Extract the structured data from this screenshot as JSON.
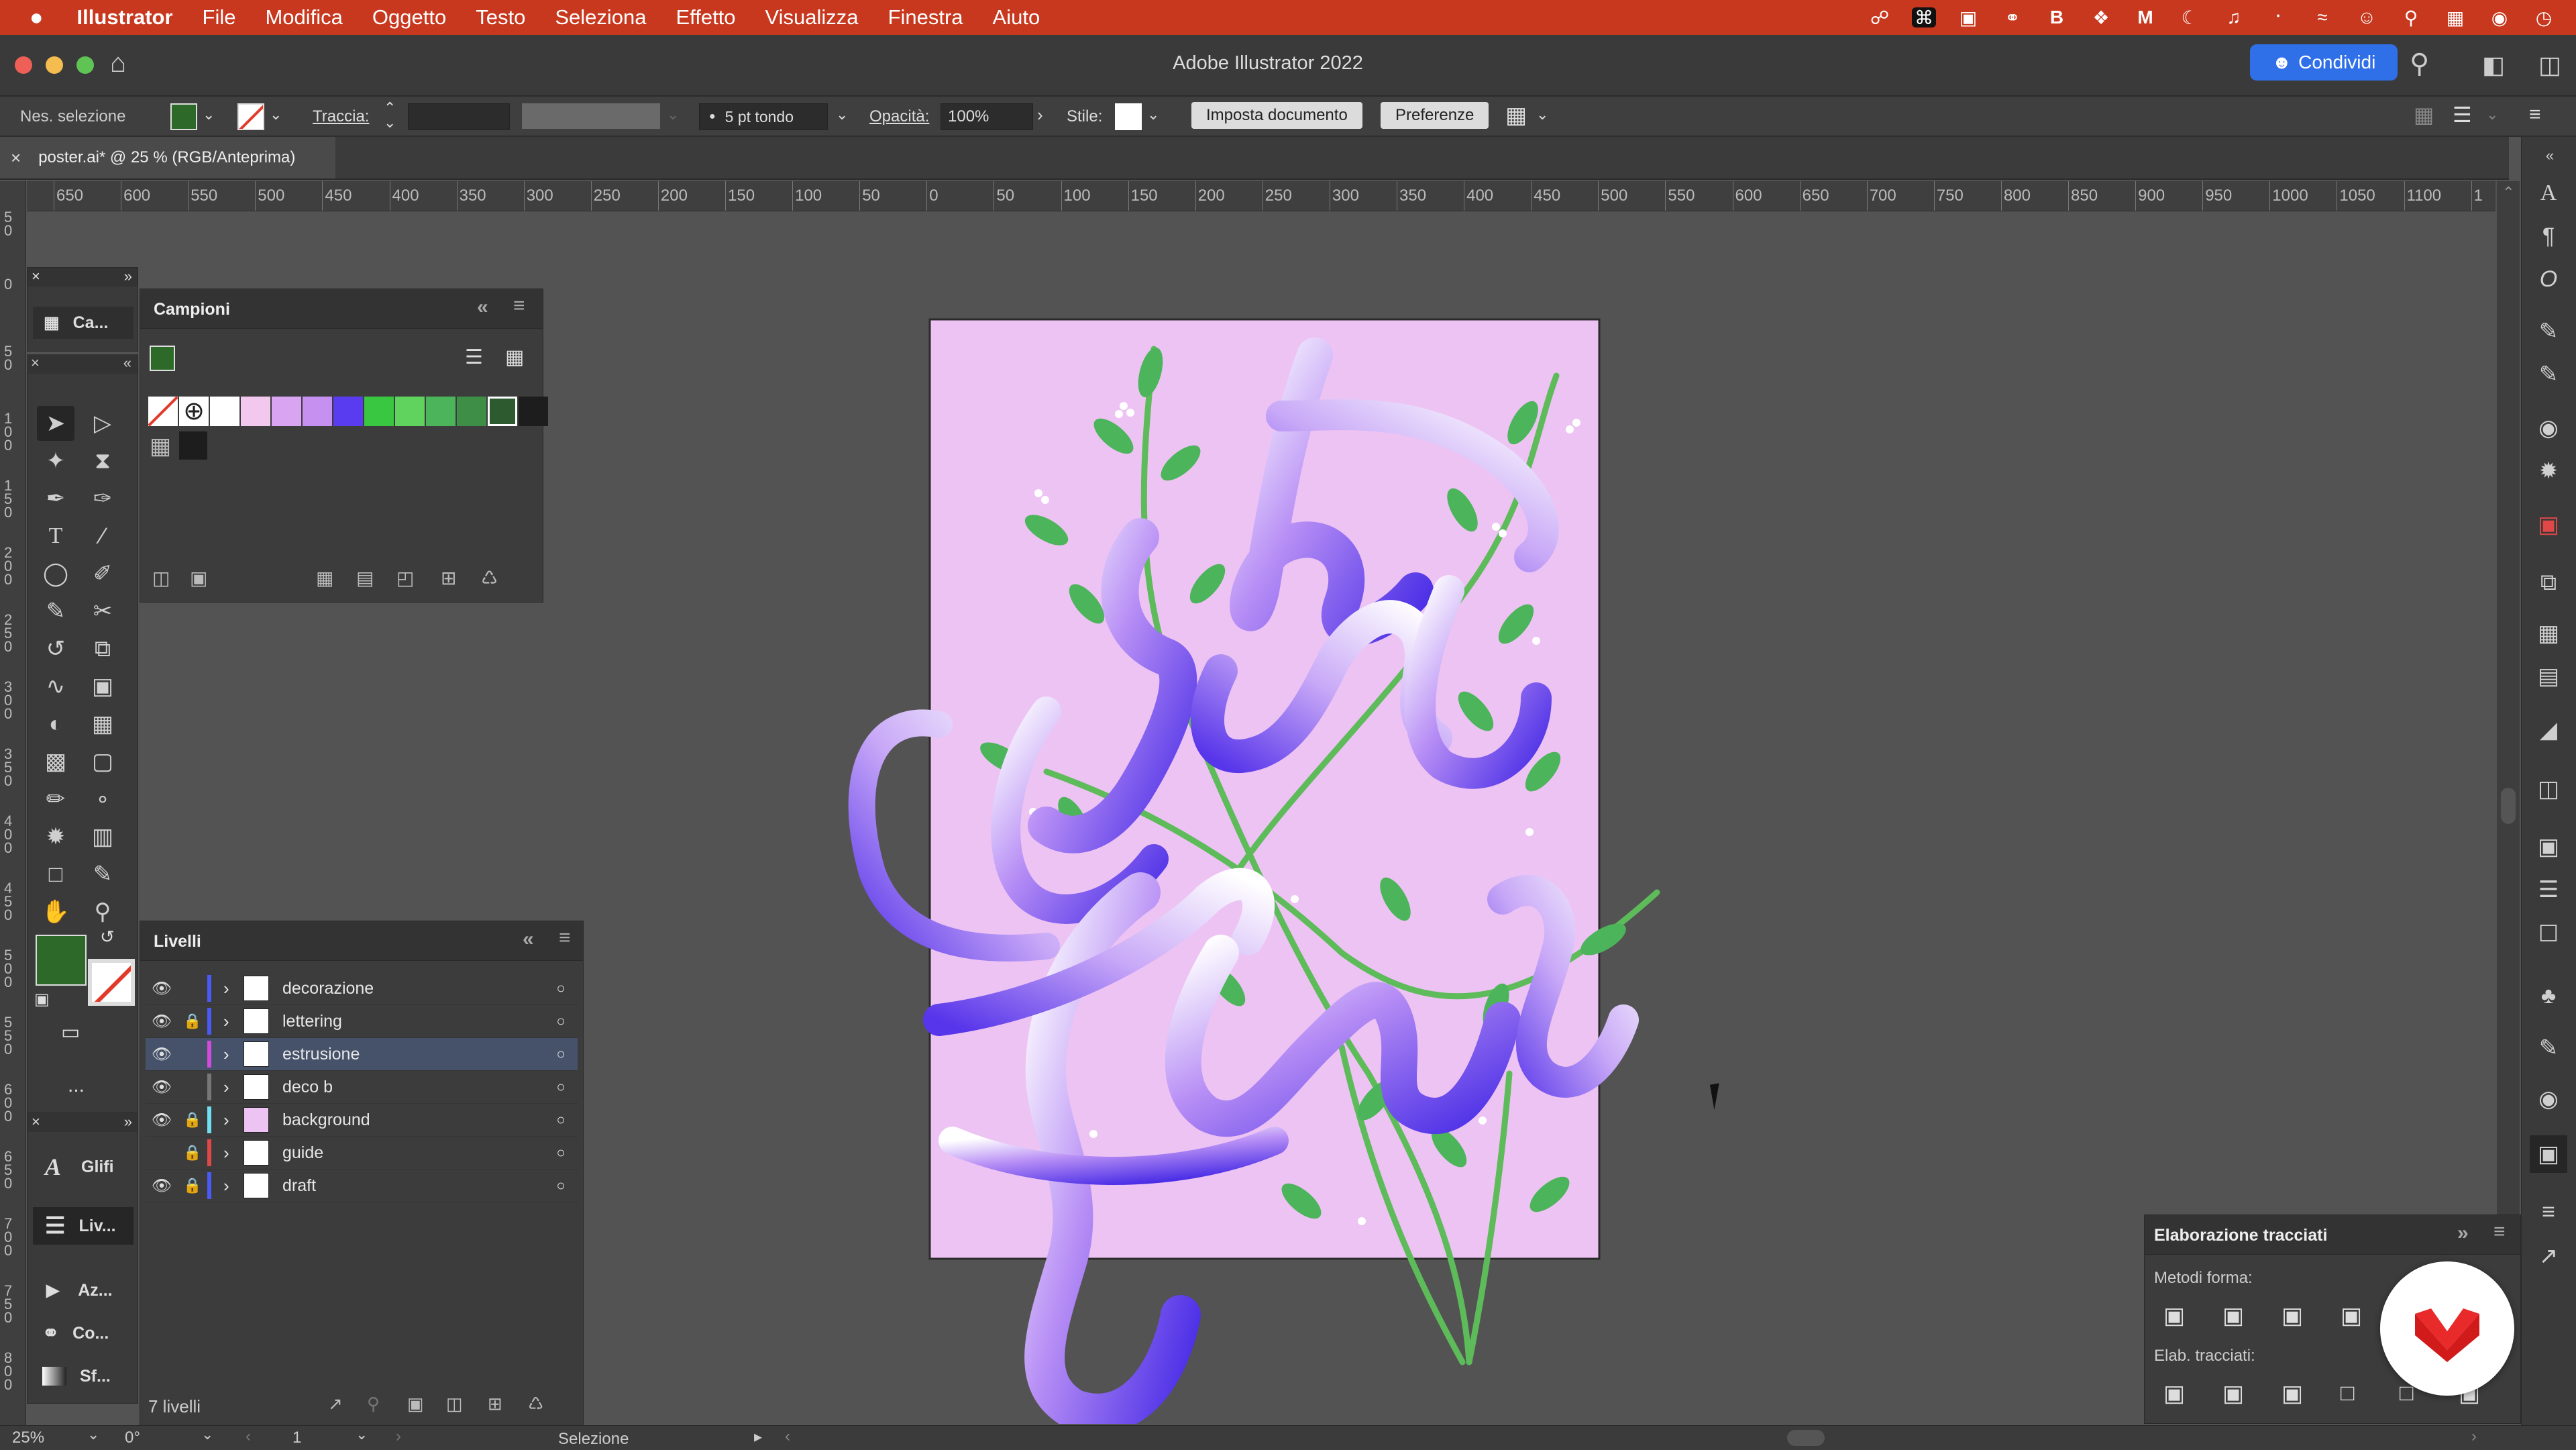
{
  "menubar": {
    "app_name": "Illustrator",
    "items": [
      "File",
      "Modifica",
      "Oggetto",
      "Testo",
      "Seleziona",
      "Effetto",
      "Visualizza",
      "Finestra",
      "Aiuto"
    ],
    "status_icons": [
      "creative-cloud-icon",
      "command-icon",
      "display-icon",
      "sync-icon",
      "b-icon",
      "dropbox-icon",
      "m-icon",
      "moon-icon",
      "headphones-icon",
      "bluetooth-icon",
      "wifi-icon",
      "user-icon",
      "search-icon",
      "control-center-icon",
      "siri-icon",
      "clock-icon"
    ]
  },
  "titlebar": {
    "title": "Adobe Illustrator 2022",
    "share_label": "Condividi"
  },
  "controlbar": {
    "selection_status": "Nes. selezione",
    "stroke_label": "Traccia:",
    "brush_label": "5 pt tondo",
    "opacity_label": "Opacità:",
    "opacity_value": "100%",
    "style_label": "Stile:",
    "document_setup_label": "Imposta documento",
    "preferences_label": "Preferenze"
  },
  "document_tab": {
    "title": "poster.ai* @ 25 % (RGB/Anteprima)"
  },
  "ruler": {
    "horizontal_ticks": [
      "650",
      "600",
      "550",
      "500",
      "450",
      "400",
      "350",
      "300",
      "250",
      "200",
      "150",
      "100",
      "50",
      "0",
      "50",
      "100",
      "150",
      "200",
      "250",
      "300",
      "350",
      "400",
      "450",
      "500",
      "550",
      "600",
      "650",
      "700",
      "750",
      "800",
      "850",
      "900",
      "950",
      "1000",
      "1050",
      "1100",
      "1"
    ],
    "vertical_ticks": [
      "5\n0",
      "0",
      "5\n0",
      "1\n0\n0",
      "1\n5\n0",
      "2\n0\n0",
      "2\n5\n0",
      "3\n0\n0",
      "3\n5\n0",
      "4\n0\n0",
      "4\n5\n0",
      "5\n0\n0",
      "5\n5\n0",
      "6\n0\n0",
      "6\n5\n0",
      "7\n0\n0",
      "7\n5\n0",
      "8\n0\n0"
    ]
  },
  "left_dock": {
    "color_short": "Ca...",
    "glyphs": "Glifi",
    "layers_short": "Liv...",
    "actions_short": "Az...",
    "links_short": "Co...",
    "gradient_short": "Sf...",
    "more": "..."
  },
  "swatches_panel": {
    "title": "Campioni",
    "colors": [
      "#ffffff",
      "#f3c8ee",
      "#d9a4f2",
      "#c690f0",
      "#5a3cf0",
      "#39c640",
      "#5fd35d",
      "#4cb45a",
      "#3e8e48",
      "#2d5b2f",
      "#1d1d1d"
    ]
  },
  "layers_panel": {
    "title": "Livelli",
    "layers": [
      {
        "name": "decorazione",
        "color": "#4a5bf5",
        "locked": false,
        "visible": true,
        "selected": false
      },
      {
        "name": "lettering",
        "color": "#4a5bf5",
        "locked": true,
        "visible": true,
        "selected": false
      },
      {
        "name": "estrusione",
        "color": "#d14bdc",
        "locked": false,
        "visible": true,
        "selected": true
      },
      {
        "name": "deco b",
        "color": "#777777",
        "locked": false,
        "visible": true,
        "selected": false
      },
      {
        "name": "background",
        "color": "#6fe0f2",
        "locked": true,
        "visible": true,
        "selected": false
      },
      {
        "name": "guide",
        "color": "#e04848",
        "locked": true,
        "visible": false,
        "selected": false
      },
      {
        "name": "draft",
        "color": "#4a5bf5",
        "locked": true,
        "visible": true,
        "selected": false
      }
    ],
    "count_label": "7 livelli"
  },
  "pathfinder_panel": {
    "title": "Elaborazione tracciati",
    "shape_modes_label": "Metodi forma:",
    "pathfinders_label": "Elab. tracciati:"
  },
  "statusbar": {
    "zoom": "25%",
    "rotation": "0°",
    "artboard": "1",
    "tool": "Selezione"
  },
  "colors": {
    "menubar": "#c8381f",
    "fill": "#2d6a2a",
    "artboard": "#edc3f3",
    "accent": "#2f6fe8"
  }
}
